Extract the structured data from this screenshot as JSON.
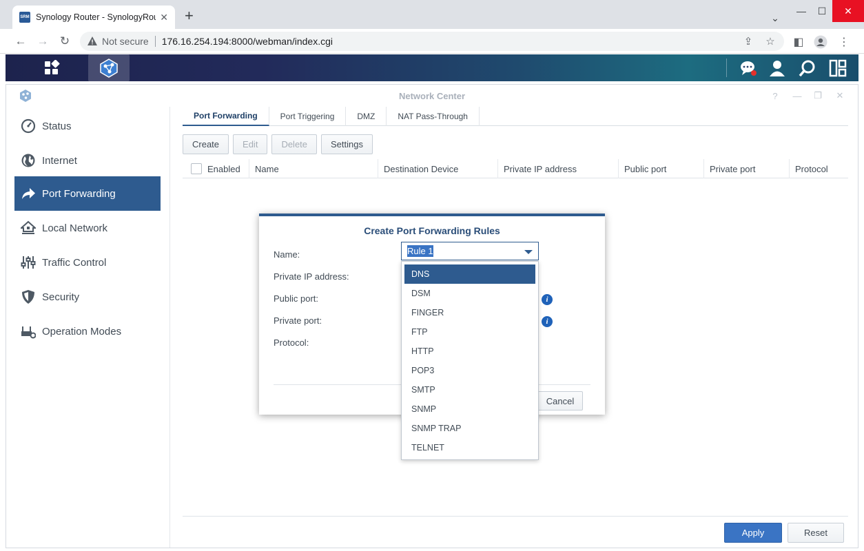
{
  "browser": {
    "tab_title": "Synology Router - SynologyRouter",
    "favicon_text": "SRM",
    "not_secure": "Not secure",
    "url": "176.16.254.194:8000/webman/index.cgi"
  },
  "window": {
    "title": "Network Center"
  },
  "sidebar": {
    "items": [
      {
        "label": "Status",
        "icon": "clock-icon"
      },
      {
        "label": "Internet",
        "icon": "globe-icon"
      },
      {
        "label": "Port Forwarding",
        "icon": "forward-arrow-icon",
        "active": true
      },
      {
        "label": "Local Network",
        "icon": "home-network-icon"
      },
      {
        "label": "Traffic Control",
        "icon": "sliders-icon"
      },
      {
        "label": "Security",
        "icon": "shield-icon"
      },
      {
        "label": "Operation Modes",
        "icon": "router-icon"
      }
    ]
  },
  "tabs": [
    "Port Forwarding",
    "Port Triggering",
    "DMZ",
    "NAT Pass-Through"
  ],
  "toolbar": {
    "create": "Create",
    "edit": "Edit",
    "delete": "Delete",
    "settings": "Settings"
  },
  "grid": {
    "columns": [
      "Enabled",
      "Name",
      "Destination Device",
      "Private IP address",
      "Public port",
      "Private port",
      "Protocol"
    ]
  },
  "footer": {
    "apply": "Apply",
    "reset": "Reset"
  },
  "modal": {
    "title": "Create Port Forwarding Rules",
    "labels": {
      "name": "Name:",
      "private_ip": "Private IP address:",
      "public_port": "Public port:",
      "private_port": "Private port:",
      "protocol": "Protocol:"
    },
    "name_value": "Rule 1",
    "cancel": "Cancel",
    "options": [
      "DNS",
      "DSM",
      "FINGER",
      "FTP",
      "HTTP",
      "POP3",
      "SMTP",
      "SNMP",
      "SNMP TRAP",
      "TELNET"
    ],
    "selected_option": "DNS"
  },
  "colors": {
    "accent": "#2e5b8f",
    "apply": "#3a74c4"
  }
}
